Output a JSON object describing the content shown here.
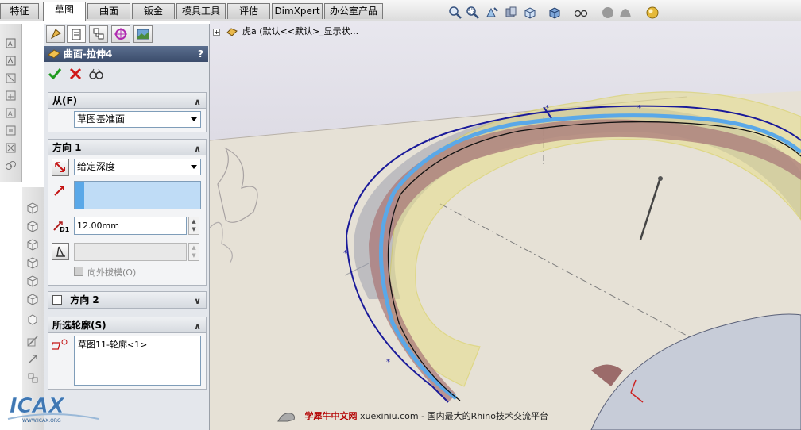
{
  "tabs": [
    "特征",
    "草图",
    "曲面",
    "钣金",
    "模具工具",
    "评估",
    "DimXpert",
    "办公室产品"
  ],
  "active_tab": "草图",
  "feature": {
    "title": "曲面-拉伸4",
    "help": "?"
  },
  "groups": {
    "from": {
      "title": "从(F)",
      "value": "草图基准面"
    },
    "direction1": {
      "title": "方向 1",
      "end_condition": "给定深度",
      "depth": "12.00mm",
      "depth_label": "D1",
      "draft_label": "向外拔模(O)"
    },
    "direction2": {
      "title": "方向 2"
    },
    "contours": {
      "title": "所选轮廓(S)",
      "items": [
        "草图11-轮廓<1>"
      ]
    }
  },
  "viewport": {
    "tree_text": "虎a (默认<<默认>_显示状...",
    "caption_brand": "学犀牛中文网",
    "caption_rest": " xuexiniu.com  - 国内最大的Rhino技术交流平台"
  },
  "logo": {
    "text": "ICAX",
    "sub": "WWW.ICAX.ORG"
  },
  "colors": {
    "title_bar": "#3b4c6b",
    "ok": "#1f9a1f",
    "cancel": "#d01818",
    "selection_blue": "#5aa8e8",
    "edge_navy": "#1a1a9a",
    "preview_yellow": "#e7de8a"
  }
}
